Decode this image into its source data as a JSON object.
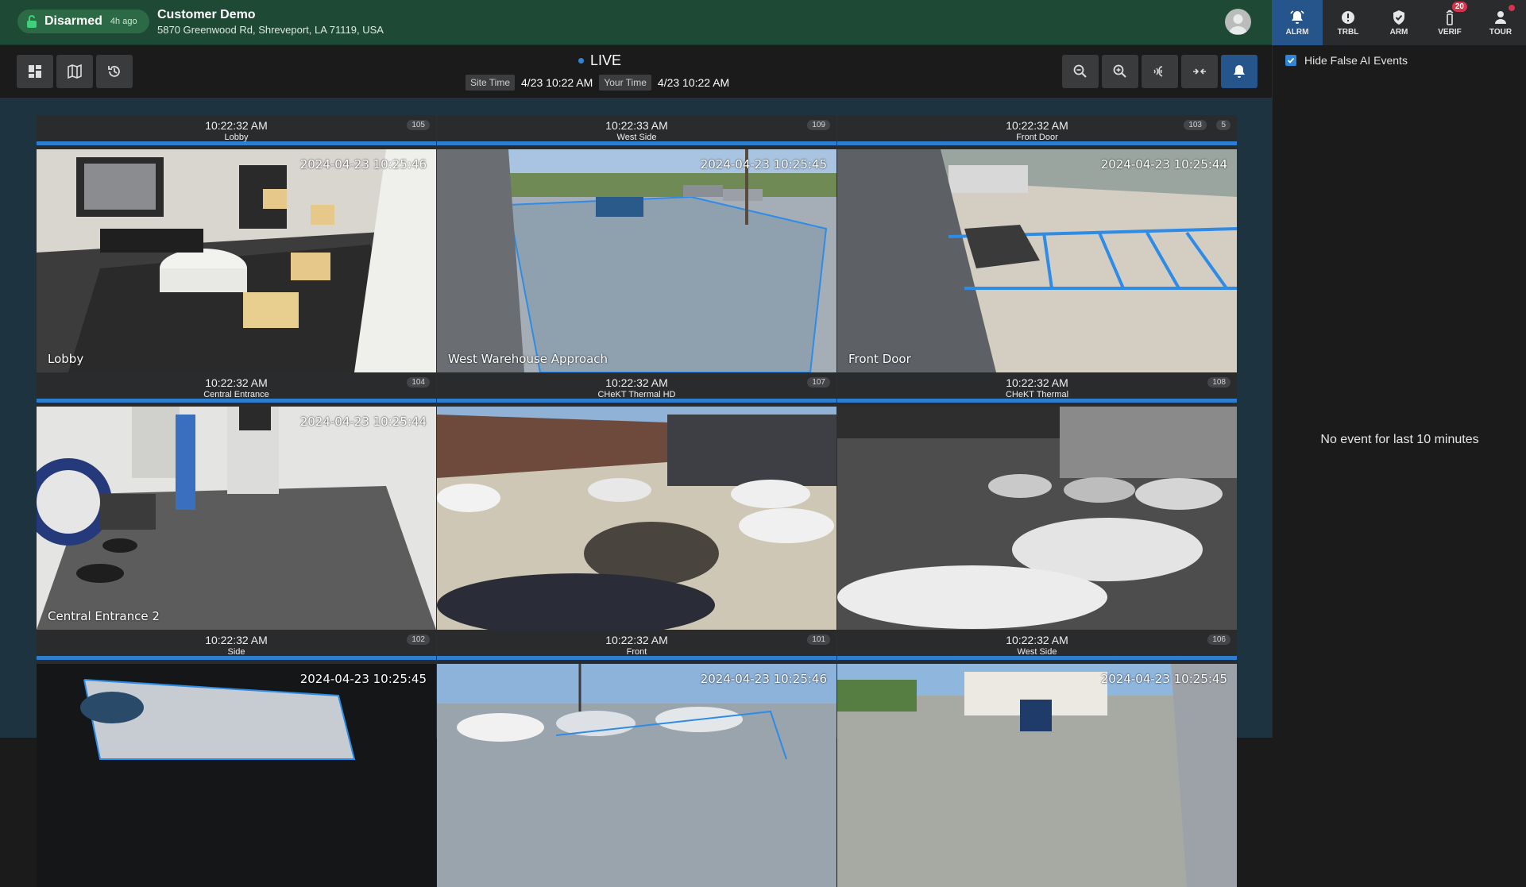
{
  "header": {
    "status": "Disarmed",
    "status_ago": "4h ago",
    "site_name": "Customer Demo",
    "site_address": "5870 Greenwood Rd, Shreveport, LA 71119, USA"
  },
  "tabs": [
    {
      "label": "ALRM",
      "icon": "bell-icon",
      "active": true
    },
    {
      "label": "TRBL",
      "icon": "alert-circle-icon"
    },
    {
      "label": "ARM",
      "icon": "shield-check-icon"
    },
    {
      "label": "VERIF",
      "icon": "signal-tower-icon",
      "badge": "20"
    },
    {
      "label": "TOUR",
      "icon": "person-icon",
      "dot": true
    }
  ],
  "toolbar": {
    "live_label": "LIVE",
    "site_time_label": "Site Time",
    "site_time": "4/23 10:22 AM",
    "your_time_label": "Your Time",
    "your_time": "4/23 10:22 AM"
  },
  "cameras": [
    {
      "time": "10:22:32 AM",
      "name": "Lobby",
      "num": "105",
      "stamp": "2024-04-23 10:25:46",
      "overlay": "Lobby"
    },
    {
      "time": "10:22:33 AM",
      "name": "West Side",
      "num": "109",
      "stamp": "2024-04-23 10:25:45",
      "overlay": "West Warehouse Approach"
    },
    {
      "time": "10:22:32 AM",
      "name": "Front Door",
      "num": "103",
      "count": "5",
      "stamp": "2024-04-23 10:25:44",
      "overlay": "Front Door"
    },
    {
      "time": "10:22:32 AM",
      "name": "Central Entrance",
      "num": "104",
      "stamp": "2024-04-23 10:25:44",
      "overlay": "Central Entrance 2"
    },
    {
      "time": "10:22:32 AM",
      "name": "CHeKT Thermal HD",
      "num": "107",
      "stamp": "",
      "overlay": ""
    },
    {
      "time": "10:22:32 AM",
      "name": "CHeKT Thermal",
      "num": "108",
      "stamp": "",
      "overlay": ""
    },
    {
      "time": "10:22:32 AM",
      "name": "Side",
      "num": "102",
      "stamp": "2024-04-23 10:25:45",
      "overlay": ""
    },
    {
      "time": "10:22:32 AM",
      "name": "Front",
      "num": "101",
      "stamp": "2024-04-23 10:25:46",
      "overlay": ""
    },
    {
      "time": "10:22:32 AM",
      "name": "West Side",
      "num": "106",
      "stamp": "2024-04-23 10:25:45",
      "overlay": ""
    }
  ],
  "panel": {
    "hide_false_ai_label": "Hide False AI Events",
    "hide_false_ai_checked": true,
    "empty_message": "No event for last 10 minutes"
  },
  "colors": {
    "header_bg": "#1e4a35",
    "accent_blue": "#2c7fd0",
    "active_tab": "#25558a",
    "badge_red": "#d8334c"
  }
}
